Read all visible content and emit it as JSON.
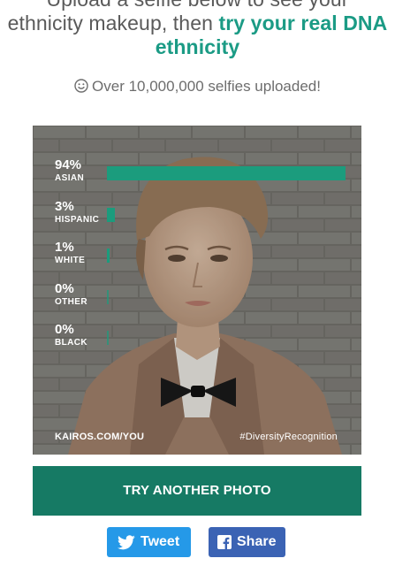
{
  "headline": {
    "line1": "Upload a selfie below to see your",
    "line2": "ethnicity makeup, then",
    "accent": "try your real DNA ethnicity"
  },
  "selfies_count": "Over 10,000,000 selfies uploaded!",
  "results": [
    {
      "percent": "94%",
      "label": "ASIAN",
      "value": 0.94
    },
    {
      "percent": "3%",
      "label": "HISPANIC",
      "value": 0.03
    },
    {
      "percent": "1%",
      "label": "WHITE",
      "value": 0.01
    },
    {
      "percent": "0%",
      "label": "OTHER",
      "value": 0.0
    },
    {
      "percent": "0%",
      "label": "BLACK",
      "value": 0.0
    }
  ],
  "footer": {
    "site": "KAIROS.COM/YOU",
    "hashtag": "#DiversityRecognition"
  },
  "buttons": {
    "try_another": "TRY ANOTHER PHOTO",
    "tweet": "Tweet",
    "share": "Share"
  },
  "colors": {
    "accent": "#1b9b85",
    "bar": "#1b9c7d",
    "button": "#167a64",
    "twitter": "#2599e8",
    "facebook": "#3b63b4"
  },
  "icons": [
    "smiley-icon",
    "twitter-bird-icon",
    "facebook-icon"
  ]
}
